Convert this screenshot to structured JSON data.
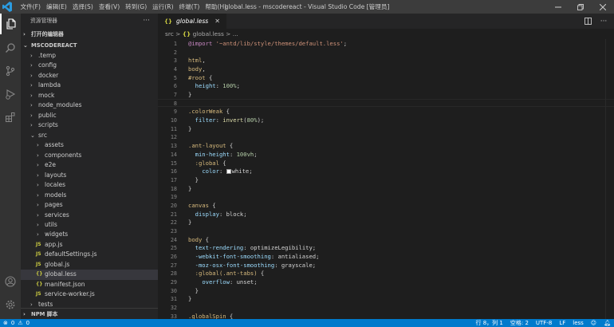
{
  "titlebar": {
    "menus": [
      "文件(F)",
      "编辑(E)",
      "选择(S)",
      "查看(V)",
      "转到(G)",
      "运行(R)",
      "终端(T)",
      "帮助(H)"
    ],
    "title": "global.less - mscodereact - Visual Studio Code [管理员]"
  },
  "activity_bar": {
    "icons": [
      "explorer-icon",
      "search-icon",
      "source-control-icon",
      "run-debug-icon",
      "extensions-icon",
      "account-icon",
      "settings-gear-icon"
    ]
  },
  "sidebar": {
    "header": "资源管理器",
    "open_editors": "打开的编辑器",
    "project": "MSCODEREACT",
    "npm": "NPM 脚本",
    "tree": [
      {
        "label": ".temp",
        "type": "folder",
        "depth": 0,
        "open": false
      },
      {
        "label": "config",
        "type": "folder",
        "depth": 0,
        "open": false
      },
      {
        "label": "docker",
        "type": "folder",
        "depth": 0,
        "open": false
      },
      {
        "label": "lambda",
        "type": "folder",
        "depth": 0,
        "open": false
      },
      {
        "label": "mock",
        "type": "folder",
        "depth": 0,
        "open": false
      },
      {
        "label": "node_modules",
        "type": "folder",
        "depth": 0,
        "open": false
      },
      {
        "label": "public",
        "type": "folder",
        "depth": 0,
        "open": false
      },
      {
        "label": "scripts",
        "type": "folder",
        "depth": 0,
        "open": false
      },
      {
        "label": "src",
        "type": "folder",
        "depth": 0,
        "open": true
      },
      {
        "label": "assets",
        "type": "folder",
        "depth": 1,
        "open": false
      },
      {
        "label": "components",
        "type": "folder",
        "depth": 1,
        "open": false
      },
      {
        "label": "e2e",
        "type": "folder",
        "depth": 1,
        "open": false
      },
      {
        "label": "layouts",
        "type": "folder",
        "depth": 1,
        "open": false
      },
      {
        "label": "locales",
        "type": "folder",
        "depth": 1,
        "open": false
      },
      {
        "label": "models",
        "type": "folder",
        "depth": 1,
        "open": false
      },
      {
        "label": "pages",
        "type": "folder",
        "depth": 1,
        "open": false
      },
      {
        "label": "services",
        "type": "folder",
        "depth": 1,
        "open": false
      },
      {
        "label": "utils",
        "type": "folder",
        "depth": 1,
        "open": false
      },
      {
        "label": "widgets",
        "type": "folder",
        "depth": 1,
        "open": false
      },
      {
        "label": "app.js",
        "type": "js",
        "depth": 1
      },
      {
        "label": "defaultSettings.js",
        "type": "js",
        "depth": 1
      },
      {
        "label": "global.js",
        "type": "js",
        "depth": 1
      },
      {
        "label": "global.less",
        "type": "less",
        "depth": 1,
        "selected": true
      },
      {
        "label": "manifest.json",
        "type": "json",
        "depth": 1
      },
      {
        "label": "service-worker.js",
        "type": "js",
        "depth": 1
      },
      {
        "label": "tests",
        "type": "folder",
        "depth": 0,
        "open": false
      }
    ],
    "file_icon_text": {
      "js": "JS",
      "less": "{}",
      "json": "{}"
    }
  },
  "editor": {
    "tab_label": "global.less",
    "tab_icon": "{}",
    "breadcrumb": {
      "folder": "src",
      "sep": ">",
      "icon": "{}",
      "file": "global.less",
      "rest": "> ..."
    },
    "lines": [
      [
        [
          "k-at",
          "@import"
        ],
        [
          "k-punc",
          " "
        ],
        [
          "k-str",
          "'~antd/lib/style/themes/default.less'"
        ],
        [
          "k-punc",
          ";"
        ]
      ],
      [],
      [
        [
          "k-sel",
          "html"
        ],
        [
          "k-punc",
          ","
        ]
      ],
      [
        [
          "k-sel",
          "body"
        ],
        [
          "k-punc",
          ","
        ]
      ],
      [
        [
          "k-sel",
          "#root"
        ],
        [
          "k-punc",
          " {"
        ]
      ],
      [
        [
          "k-punc",
          "  "
        ],
        [
          "k-prop",
          "height"
        ],
        [
          "k-punc",
          ": "
        ],
        [
          "k-num",
          "100%"
        ],
        [
          "k-punc",
          ";"
        ]
      ],
      [
        [
          "k-punc",
          "}"
        ]
      ],
      [],
      [
        [
          "k-sel",
          ".colorWeak"
        ],
        [
          "k-punc",
          " {"
        ]
      ],
      [
        [
          "k-punc",
          "  "
        ],
        [
          "k-prop",
          "filter"
        ],
        [
          "k-punc",
          ": "
        ],
        [
          "k-fn",
          "invert"
        ],
        [
          "k-punc",
          "("
        ],
        [
          "k-num",
          "80%"
        ],
        [
          "k-punc",
          ");"
        ]
      ],
      [
        [
          "k-punc",
          "}"
        ]
      ],
      [],
      [
        [
          "k-sel",
          ".ant-layout"
        ],
        [
          "k-punc",
          " {"
        ]
      ],
      [
        [
          "k-punc",
          "  "
        ],
        [
          "k-prop",
          "min-height"
        ],
        [
          "k-punc",
          ": "
        ],
        [
          "k-num",
          "100vh"
        ],
        [
          "k-punc",
          ";"
        ]
      ],
      [
        [
          "k-punc",
          "  "
        ],
        [
          "k-sel",
          ":global"
        ],
        [
          "k-punc",
          " {"
        ]
      ],
      [
        [
          "k-punc",
          "    "
        ],
        [
          "k-prop",
          "color"
        ],
        [
          "k-punc",
          ": "
        ],
        [
          "swatch",
          ""
        ],
        [
          "k-punc",
          "white;"
        ]
      ],
      [
        [
          "k-punc",
          "  }"
        ]
      ],
      [
        [
          "k-punc",
          "}"
        ]
      ],
      [],
      [
        [
          "k-sel",
          "canvas"
        ],
        [
          "k-punc",
          " {"
        ]
      ],
      [
        [
          "k-punc",
          "  "
        ],
        [
          "k-prop",
          "display"
        ],
        [
          "k-punc",
          ": block;"
        ]
      ],
      [
        [
          "k-punc",
          "}"
        ]
      ],
      [],
      [
        [
          "k-sel",
          "body"
        ],
        [
          "k-punc",
          " {"
        ]
      ],
      [
        [
          "k-punc",
          "  "
        ],
        [
          "k-prop",
          "text-rendering"
        ],
        [
          "k-punc",
          ": optimizeLegibility;"
        ]
      ],
      [
        [
          "k-punc",
          "  "
        ],
        [
          "k-prop",
          "-webkit-font-smoothing"
        ],
        [
          "k-punc",
          ": antialiased;"
        ]
      ],
      [
        [
          "k-punc",
          "  "
        ],
        [
          "k-prop",
          "-moz-osx-font-smoothing"
        ],
        [
          "k-punc",
          ": grayscale;"
        ]
      ],
      [
        [
          "k-punc",
          "  "
        ],
        [
          "k-sel",
          ":global(.ant-tabs)"
        ],
        [
          "k-punc",
          " {"
        ]
      ],
      [
        [
          "k-punc",
          "    "
        ],
        [
          "k-prop",
          "overflow"
        ],
        [
          "k-punc",
          ": unset;"
        ]
      ],
      [
        [
          "k-punc",
          "  }"
        ]
      ],
      [
        [
          "k-punc",
          "}"
        ]
      ],
      [],
      [
        [
          "k-sel",
          ".globalSpin"
        ],
        [
          "k-punc",
          " {"
        ]
      ]
    ],
    "current_line": 8
  },
  "statusbar": {
    "errors": "0",
    "warnings": "0",
    "position": "行 8，列 1",
    "spaces": "空格: 2",
    "encoding": "UTF-8",
    "eol": "LF",
    "language": "less"
  },
  "colors": {
    "titlebar": "#3c3c3c",
    "activity": "#333333",
    "sidebar": "#252526",
    "editor": "#1e1e1e",
    "status": "#007acc",
    "folder_js": "#cbcb41"
  }
}
